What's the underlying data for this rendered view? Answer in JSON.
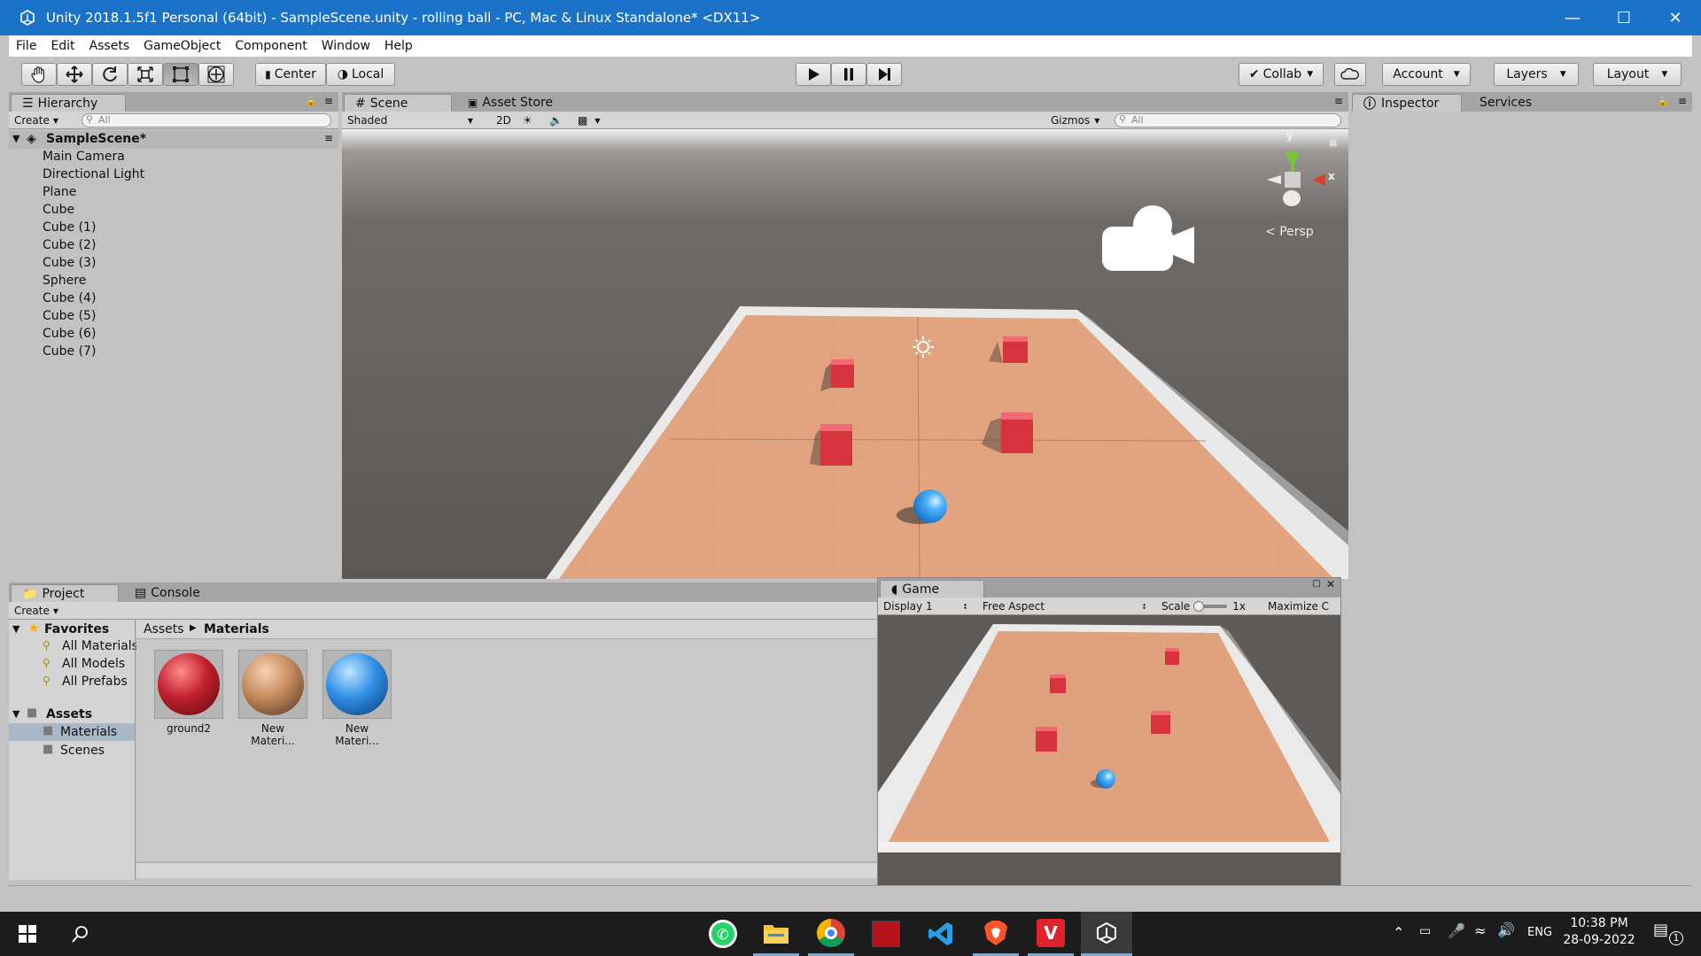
{
  "window": {
    "title": "Unity 2018.1.5f1 Personal (64bit) - SampleScene.unity - rolling ball - PC, Mac & Linux Standalone* <DX11>"
  },
  "menu": [
    "File",
    "Edit",
    "Assets",
    "GameObject",
    "Component",
    "Window",
    "Help"
  ],
  "toolbar": {
    "center": "Center",
    "local": "Local",
    "collab": "Collab",
    "account": "Account",
    "layers": "Layers",
    "layout": "Layout"
  },
  "hierarchy": {
    "tab": "Hierarchy",
    "create": "Create",
    "search_placeholder": "All",
    "scene": "SampleScene*",
    "items": [
      "Main Camera",
      "Directional Light",
      "Plane",
      "Cube",
      "Cube (1)",
      "Cube (2)",
      "Cube (3)",
      "Sphere",
      "Cube (4)",
      "Cube (5)",
      "Cube (6)",
      "Cube (7)"
    ]
  },
  "scene": {
    "tab": "Scene",
    "asset_store": "Asset Store",
    "shading": "Shaded",
    "mode2d": "2D",
    "gizmos": "Gizmos",
    "search_placeholder": "All",
    "persp": "Persp",
    "axis_x": "x",
    "axis_y": "y"
  },
  "inspector": {
    "tab": "Inspector",
    "services": "Services"
  },
  "project": {
    "tab": "Project",
    "console": "Console",
    "create": "Create",
    "favorites": "Favorites",
    "fav_items": [
      "All Materials",
      "All Models",
      "All Prefabs"
    ],
    "assets": "Assets",
    "asset_items": [
      "Materials",
      "Scenes"
    ],
    "breadcrumb_root": "Assets",
    "breadcrumb_current": "Materials",
    "materials": [
      {
        "name": "ground2",
        "color": "#c0202e"
      },
      {
        "name": "New Materi...",
        "color": "#c48a5c"
      },
      {
        "name": "New Materi...",
        "color": "#2f8fe6"
      }
    ]
  },
  "game": {
    "tab": "Game",
    "display": "Display 1",
    "aspect": "Free Aspect",
    "scale_label": "Scale",
    "scale_value": "1x",
    "maximize": "Maximize C"
  },
  "taskbar": {
    "lang": "ENG",
    "time": "10:38 PM",
    "date": "28-09-2022",
    "notif": "1"
  }
}
